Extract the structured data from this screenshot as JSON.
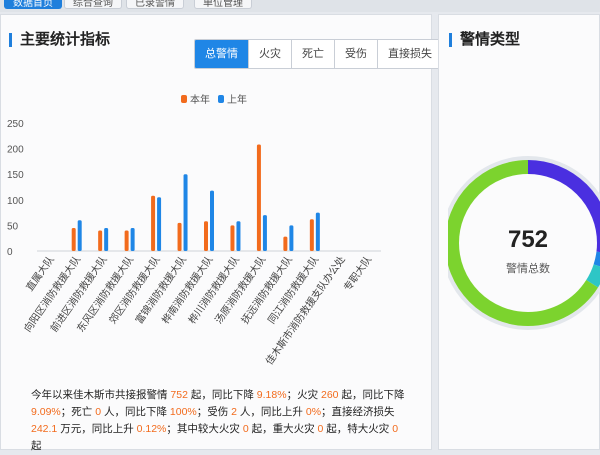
{
  "topbar": {
    "tabs": [
      {
        "label": "数据首页"
      },
      {
        "label": "综合查询"
      },
      {
        "label": "已录警情"
      },
      {
        "label": "单位管理"
      }
    ]
  },
  "left_panel": {
    "title": "主要统计指标",
    "filter_buttons": [
      "总警情",
      "火灾",
      "死亡",
      "受伤",
      "直接损失"
    ],
    "active_filter": "总警情"
  },
  "right_panel": {
    "title": "警情类型",
    "total_value": "752",
    "total_label": "警情总数"
  },
  "colors": {
    "this_year": "#f26b1d",
    "last_year": "#1f86e6",
    "donut": [
      "#4a2fe0",
      "#1f86e6",
      "#2ec6c6",
      "#7cd32e"
    ]
  },
  "chart_data": {
    "type": "bar",
    "categories": [
      "直属大队",
      "向阳区消防救援大队",
      "前进区消防救援大队",
      "东风区消防救援大队",
      "郊区消防救援大队",
      "富锦消防救援大队",
      "桦南消防救援大队",
      "桦川消防救援大队",
      "汤原消防救援大队",
      "抚远消防救援大队",
      "同江消防救援大队",
      "佳木斯市消防救援支队办公处",
      "专职大队"
    ],
    "series": [
      {
        "name": "本年",
        "values": [
          0,
          45,
          40,
          40,
          108,
          55,
          58,
          50,
          208,
          28,
          62,
          0,
          0
        ]
      },
      {
        "name": "上年",
        "values": [
          0,
          60,
          45,
          45,
          105,
          150,
          118,
          58,
          70,
          50,
          75,
          0,
          0
        ]
      }
    ],
    "ylim": [
      0,
      250
    ],
    "yticks": [
      0,
      50,
      100,
      150,
      200,
      250
    ],
    "legend": "top-center",
    "grid": false
  },
  "donut_data": {
    "type": "pie",
    "values": [
      27,
      3,
      4,
      66
    ]
  },
  "summary": {
    "p1": "今年以来佳木斯市共接报警情 ",
    "total": "752",
    "p2": " 起，同比下降 ",
    "total_change": "9.18%",
    "p3": "；火灾 ",
    "fire": "260",
    "p4": " 起，同比下降 ",
    "fire_change": "9.09%",
    "p5": "；死亡 ",
    "death": "0",
    "p6": " 人，同比下降 ",
    "death_change": "100%",
    "p7": "；受伤 ",
    "injury": "2",
    "p8": " 人，同比上升 ",
    "injury_change": "0%",
    "p9": "；直接经济损失 ",
    "loss": "242.1",
    "p10": " 万元，同比上升 ",
    "loss_change": "0.12%",
    "p11": "；其中较大火灾 ",
    "major_fire": "0",
    "p12": " 起，重大火灾 ",
    "severe_fire": "0",
    "p13": " 起，特大火灾 ",
    "extreme_fire": "0",
    "p14": " 起"
  }
}
